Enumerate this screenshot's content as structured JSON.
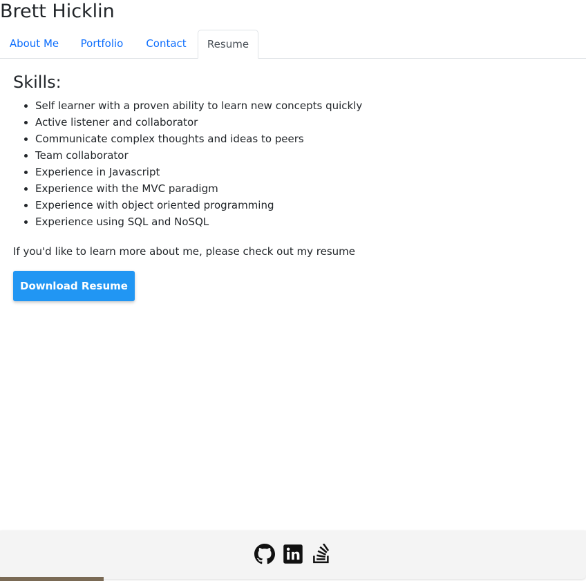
{
  "header": {
    "title": "Brett Hicklin"
  },
  "tabs": [
    {
      "label": "About Me",
      "active": false
    },
    {
      "label": "Portfolio",
      "active": false
    },
    {
      "label": "Contact",
      "active": false
    },
    {
      "label": "Resume",
      "active": true
    }
  ],
  "resume": {
    "skills_heading": "Skills:",
    "skills": [
      "Self learner with a proven ability to learn new concepts quickly",
      "Active listener and collaborator",
      "Communicate complex thoughts and ideas to peers",
      "Team collaborator",
      "Experience in Javascript",
      "Experience with the MVC paradigm",
      "Experience with object oriented programming",
      "Experience using SQL and NoSQL"
    ],
    "intro": "If you'd like to learn more about me, please check out my resume",
    "download_label": "Download Resume"
  },
  "footer": {
    "icons": [
      "github-icon",
      "linkedin-icon",
      "stack-overflow-icon"
    ]
  },
  "colors": {
    "accent": "#2196f3",
    "link": "#0d6efd",
    "footer_bg": "#f4f4f4"
  }
}
